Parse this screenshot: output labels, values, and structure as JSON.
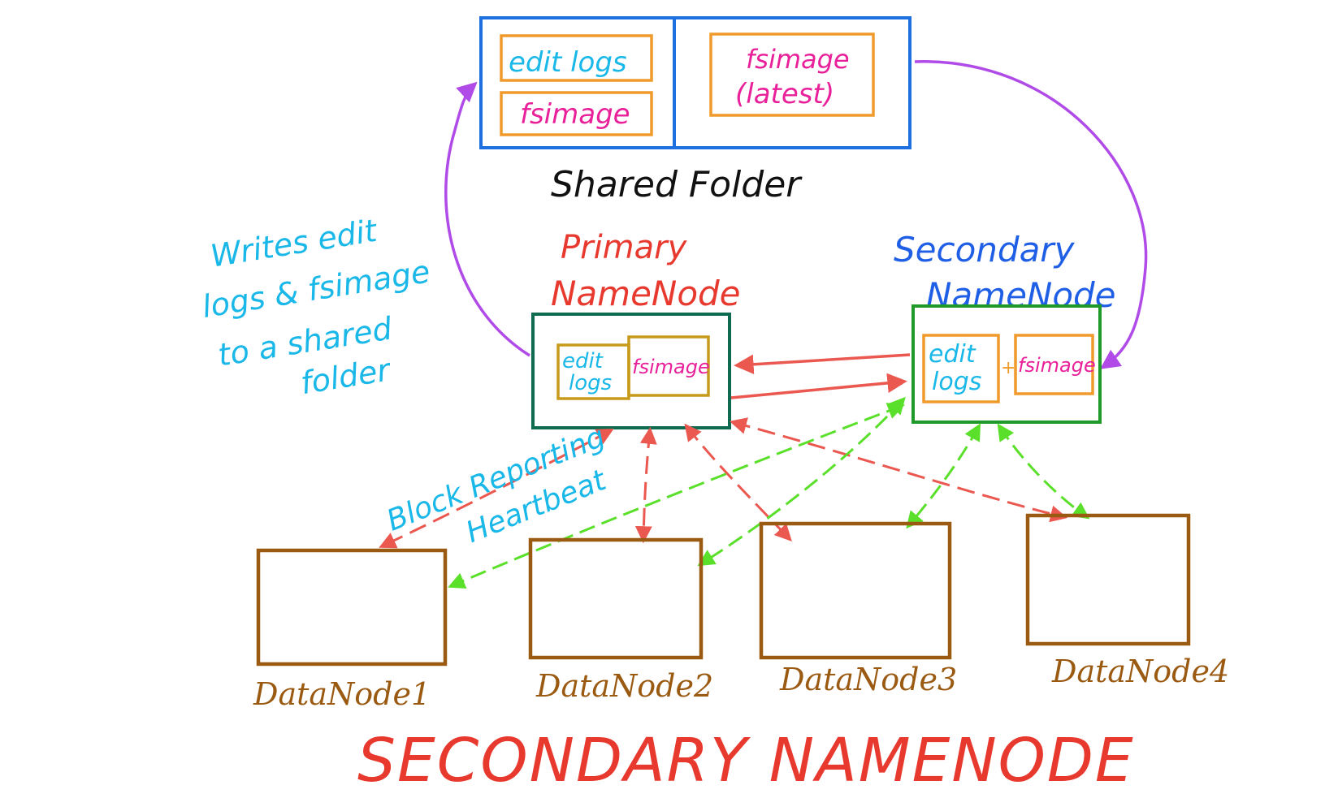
{
  "colors": {
    "shared": "#1e6fe0",
    "orange": "#f09a2b",
    "cyan": "#19b8e8",
    "magenta": "#e8209a",
    "black": "#111111",
    "red": "#e8392f",
    "blue": "#1f5fe6",
    "primary_box": "#0f6b4f",
    "secondary_box": "#1f9a2a",
    "gold": "#c89a1a",
    "purple": "#b04be8",
    "salmon": "#ea5850",
    "green": "#5ae02a",
    "brown": "#9a5a12"
  },
  "shared_folder": {
    "edit_logs": "edit logs",
    "fsimage": "fsimage",
    "fsimage_latest_1": "fsimage",
    "fsimage_latest_2": "(latest)",
    "label": "Shared Folder"
  },
  "writes_note": [
    "Writes edit",
    "logs & fsimage",
    "to a shared",
    "folder"
  ],
  "primary": {
    "title_1": "Primary",
    "title_2": "NameNode",
    "edit_1": "edit",
    "edit_2": "logs",
    "fsimage": "fsimage"
  },
  "secondary": {
    "title_1": "Secondary",
    "title_2": "NameNode",
    "edit_1": "edit",
    "edit_2": "logs",
    "plus": "+",
    "fsimage": "fsimage"
  },
  "reporting": {
    "block": "Block Reporting",
    "heartbeat": "Heartbeat"
  },
  "datanodes": [
    "DataNode1",
    "DataNode2",
    "DataNode3",
    "DataNode4"
  ],
  "footer_title": "SECONDARY NAMENODE"
}
